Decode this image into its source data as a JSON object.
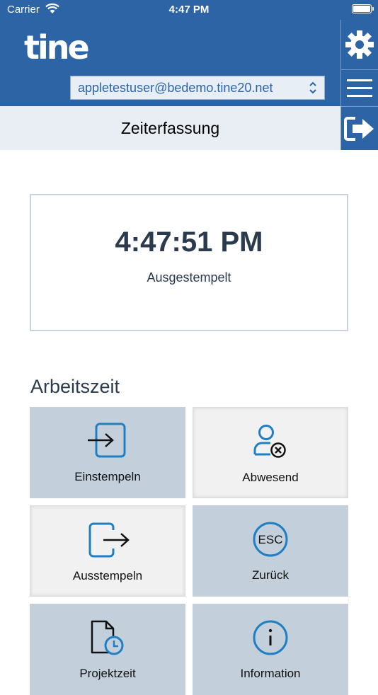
{
  "status_bar": {
    "carrier": "Carrier",
    "time": "4:47 PM"
  },
  "header": {
    "logo": "tine",
    "account": "appletestuser@bedemo.tine20.net",
    "side_icons": [
      "gear-icon",
      "menu-icon",
      "logout-icon"
    ]
  },
  "page_title": "Zeiterfassung",
  "clock": {
    "time": "4:47:51 PM",
    "status": "Ausgestempelt"
  },
  "section_title": "Arbeitszeit",
  "tiles": [
    {
      "label": "Einstempeln",
      "icon": "clock-in-icon"
    },
    {
      "label": "Abwesend",
      "icon": "absent-user-icon"
    },
    {
      "label": "Ausstempeln",
      "icon": "clock-out-icon"
    },
    {
      "label": "Zurück",
      "icon": "escape-icon"
    },
    {
      "label": "Projektzeit",
      "icon": "project-time-icon"
    },
    {
      "label": "Information",
      "icon": "info-icon"
    }
  ],
  "colors": {
    "brand_blue": "#2d64a5",
    "tile_blue": "#c3d0db",
    "tile_grey": "#f1f1f1",
    "icon_blue": "#1f7fc2"
  }
}
